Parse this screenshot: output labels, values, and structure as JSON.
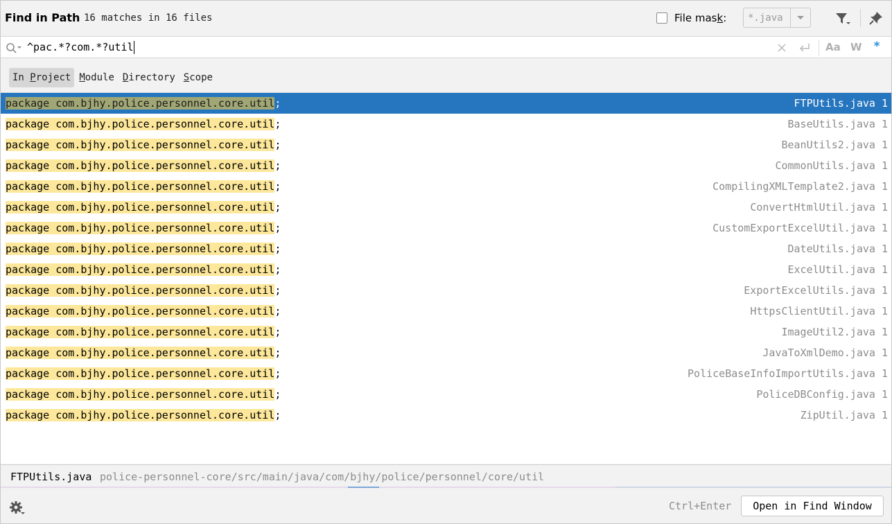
{
  "header": {
    "title": "Find in Path",
    "match_count": "16 matches in 16 files",
    "file_mask_label_pre": "File mas",
    "file_mask_label_u": "k",
    "file_mask_label_post": ":",
    "file_mask_value": "*.java",
    "file_mask_checked": false
  },
  "search": {
    "query": "^pac.*?com.*?util",
    "case_label": "Aa",
    "word_label": "W",
    "regex_label": "*",
    "regex_enabled": true
  },
  "scope": {
    "tabs": [
      {
        "pre": "In ",
        "u": "P",
        "post": "roject",
        "active": true
      },
      {
        "pre": "",
        "u": "M",
        "post": "odule",
        "active": false
      },
      {
        "pre": "",
        "u": "D",
        "post": "irectory",
        "active": false
      },
      {
        "pre": "",
        "u": "S",
        "post": "cope",
        "active": false
      }
    ]
  },
  "results": [
    {
      "line_match": "package com.bjhy.police.personnel.core.util",
      "line_rest": ";",
      "file": "FTPUtils.java 1",
      "selected": true
    },
    {
      "line_match": "package com.bjhy.police.personnel.core.util",
      "line_rest": ";",
      "file": "BaseUtils.java 1",
      "selected": false
    },
    {
      "line_match": "package com.bjhy.police.personnel.core.util",
      "line_rest": ";",
      "file": "BeanUtils2.java 1",
      "selected": false
    },
    {
      "line_match": "package com.bjhy.police.personnel.core.util",
      "line_rest": ";",
      "file": "CommonUtils.java 1",
      "selected": false
    },
    {
      "line_match": "package com.bjhy.police.personnel.core.util",
      "line_rest": ";",
      "file": "CompilingXMLTemplate2.java 1",
      "selected": false
    },
    {
      "line_match": "package com.bjhy.police.personnel.core.util",
      "line_rest": ";",
      "file": "ConvertHtmlUtil.java 1",
      "selected": false
    },
    {
      "line_match": "package com.bjhy.police.personnel.core.util",
      "line_rest": ";",
      "file": "CustomExportExcelUtil.java 1",
      "selected": false
    },
    {
      "line_match": "package com.bjhy.police.personnel.core.util",
      "line_rest": ";",
      "file": "DateUtils.java 1",
      "selected": false
    },
    {
      "line_match": "package com.bjhy.police.personnel.core.util",
      "line_rest": ";",
      "file": "ExcelUtil.java 1",
      "selected": false
    },
    {
      "line_match": "package com.bjhy.police.personnel.core.util",
      "line_rest": ";",
      "file": "ExportExcelUtils.java 1",
      "selected": false
    },
    {
      "line_match": "package com.bjhy.police.personnel.core.util",
      "line_rest": ";",
      "file": "HttpsClientUtil.java 1",
      "selected": false
    },
    {
      "line_match": "package com.bjhy.police.personnel.core.util",
      "line_rest": ";",
      "file": "ImageUtil2.java 1",
      "selected": false
    },
    {
      "line_match": "package com.bjhy.police.personnel.core.util",
      "line_rest": ";",
      "file": "JavaToXmlDemo.java 1",
      "selected": false
    },
    {
      "line_match": "package com.bjhy.police.personnel.core.util",
      "line_rest": ";",
      "file": "PoliceBaseInfoImportUtils.java 1",
      "selected": false
    },
    {
      "line_match": "package com.bjhy.police.personnel.core.util",
      "line_rest": ";",
      "file": "PoliceDBConfig.java 1",
      "selected": false
    },
    {
      "line_match": "package com.bjhy.police.personnel.core.util",
      "line_rest": ";",
      "file": "ZipUtil.java 1",
      "selected": false
    }
  ],
  "preview": {
    "file": "FTPUtils.java",
    "path": "police-personnel-core/src/main/java/com/bjhy/police/personnel/core/util"
  },
  "footer": {
    "shortcut": "Ctrl+Enter",
    "open_button": "Open in Find Window"
  },
  "colors": {
    "selection": "#2675bf",
    "match_highlight": "#fce79a",
    "regex_accent": "#2f8fd8"
  }
}
